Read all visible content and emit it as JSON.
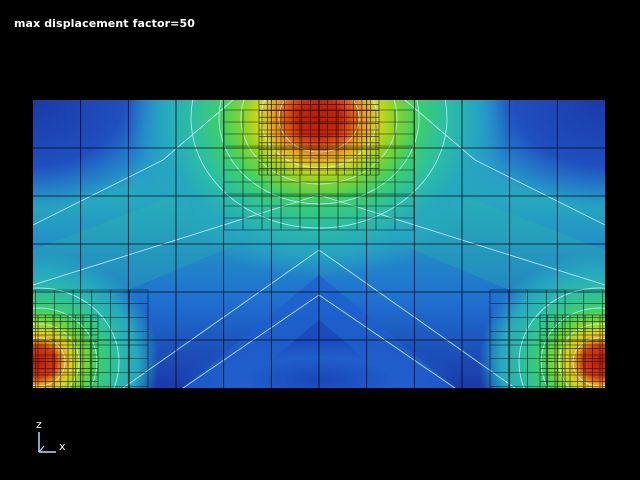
{
  "viewport": {
    "title": "max displacement factor=50",
    "background": "#000000"
  },
  "contour_plot": {
    "colormap": [
      "#1a3aa8",
      "#1f61cf",
      "#2a86d8",
      "#26a8bf",
      "#2cbfa0",
      "#3ccf6a",
      "#86d52a",
      "#d8d51c",
      "#e8a018",
      "#e05a10",
      "#b81a08"
    ],
    "mesh_color": "#000000",
    "contour_line_color": "#c8f0ff",
    "hotspots": [
      "top-center",
      "bottom-left",
      "bottom-right"
    ]
  },
  "axis_triad": {
    "vertical_axis": "z",
    "horizontal_axis": "x",
    "color": "#c0d8ff"
  }
}
